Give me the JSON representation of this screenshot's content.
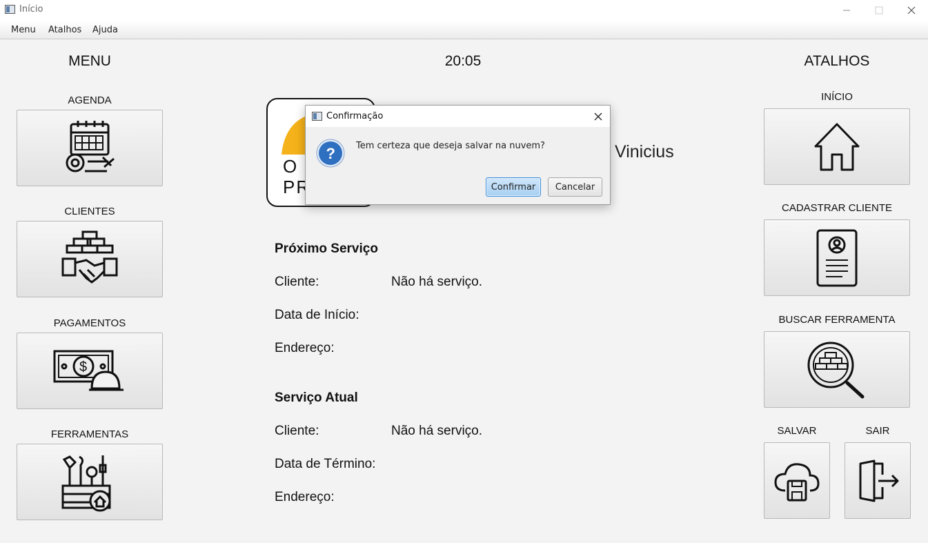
{
  "window": {
    "title": "Início",
    "icon": "java-app-icon"
  },
  "menubar": {
    "items": [
      "Menu",
      "Atalhos",
      "Ajuda"
    ]
  },
  "left": {
    "heading": "MENU",
    "buttons": [
      {
        "label": "AGENDA",
        "icon": "calendar-tools-icon"
      },
      {
        "label": "CLIENTES",
        "icon": "handshake-bricks-icon"
      },
      {
        "label": "PAGAMENTOS",
        "icon": "money-helmet-icon"
      },
      {
        "label": "FERRAMENTAS",
        "icon": "toolbox-icon"
      }
    ]
  },
  "center": {
    "clock": "20:05",
    "logo_lines": [
      "O",
      "PR"
    ],
    "greeting_tail": "Vinicius",
    "next_service": {
      "title": "Próximo Serviço",
      "client_label": "Cliente:",
      "client_value": "Não há serviço.",
      "start_label": "Data de Início:",
      "address_label": "Endereço:"
    },
    "current_service": {
      "title": "Serviço Atual",
      "client_label": "Cliente:",
      "client_value": "Não há serviço.",
      "end_label": "Data de Término:",
      "address_label": "Endereço:"
    }
  },
  "right": {
    "heading": "ATALHOS",
    "buttons": [
      {
        "label": "INÍCIO",
        "icon": "home-icon"
      },
      {
        "label": "CADASTRAR CLIENTE",
        "icon": "id-card-icon"
      },
      {
        "label": "BUSCAR FERRAMENTA",
        "icon": "search-bricks-icon"
      },
      {
        "label": "SALVAR",
        "icon": "cloud-save-icon"
      },
      {
        "label": "SAIR",
        "icon": "exit-door-icon"
      }
    ]
  },
  "dialog": {
    "title": "Confirmação",
    "message": "Tem certeza que deseja salvar na nuvem?",
    "icon": "question-icon",
    "confirm_label": "Confirmar",
    "cancel_label": "Cancelar"
  },
  "colors": {
    "helmet": "#f5b21a",
    "dialog_primary": "#a8d0f2",
    "question_icon": "#2f6fc0"
  }
}
